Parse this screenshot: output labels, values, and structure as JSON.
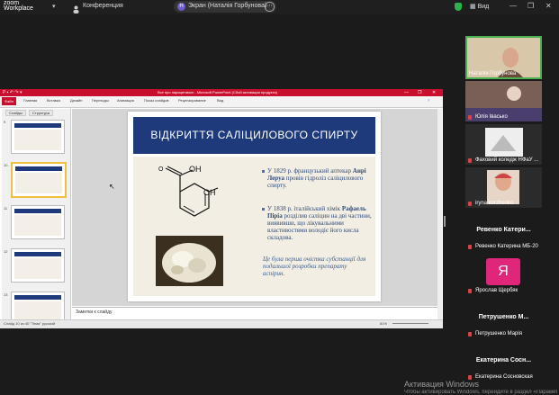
{
  "zoom": {
    "logo_line1": "zoom",
    "logo_line2": "Workplace",
    "conference_label": "Конференция",
    "share_avatar_letter": "Н",
    "share_label": "Экран (Наталія Горбунова)",
    "view_label": "Вид"
  },
  "powerpoint": {
    "window_title": "Все про парацетамол - Microsoft PowerPoint (Сбой активации продукта)",
    "file_tab": "Файл",
    "tabs": [
      "Главная",
      "Вставка",
      "Дизайн",
      "Переходы",
      "Анимация",
      "Показ слайдов",
      "Рецензирование",
      "Вид"
    ],
    "panel_tabs": [
      "Слайды",
      "Структура"
    ],
    "thumb_numbers": [
      "9",
      "10",
      "11",
      "12",
      "13"
    ],
    "notes_placeholder": "Заметки к слайду",
    "status": "Слайд 10 из 40   \"Тема\"   русский",
    "zoom_level": "81%"
  },
  "slide": {
    "title": "ВІДКРИТТЯ САЛІЦИЛОВОГО СПИРТУ",
    "bullet1_pre": "У 1829 р. французький аптекар ",
    "bullet1_name": "Анрі Леруа",
    "bullet1_post": " провів гідроліз саліцилового спирту.",
    "bullet2_pre": "У 1838 р. італійський хімік ",
    "bullet2_name": "Рафаель Піріа",
    "bullet2_post": " розділив саліцин на дві частини, виявивши, що лікувальними властивостями володіє його кисла складова.",
    "conclusion": "Це була перша очістка субстанції для подальшої розробки препарату аспірин.",
    "oh_top": "OH",
    "oh_side": "OH"
  },
  "participants": [
    {
      "name": "Наталія Горбунова",
      "muted": false
    },
    {
      "name": "Юлія Івасько",
      "muted": true
    },
    {
      "name": "Фаховий коледж НФаУ ...",
      "muted": true
    },
    {
      "name": "iryna korzhenko",
      "muted": true
    },
    {
      "name": "Ревенко Катерина МБ-20",
      "display": "Ревенко Катери...",
      "muted": true
    },
    {
      "name": "Ярослав Щербяк",
      "avatar_letter": "Я",
      "muted": true
    },
    {
      "name": "Петрушенко Марія",
      "display": "Петрушенко М...",
      "muted": true
    },
    {
      "name": "Екатерина Сосновская",
      "display": "Екатерина Сосн...",
      "muted": true
    }
  ],
  "watermark": {
    "line1": "Активация Windows",
    "line2": "Чтобы активировать Windows, перейдите в раздел «Параметры»."
  },
  "colors": {
    "slide_header": "#1f3a7a",
    "slide_body": "#f2eee3",
    "pp_accent": "#c8102e",
    "active_speaker_border": "#4caf50"
  }
}
